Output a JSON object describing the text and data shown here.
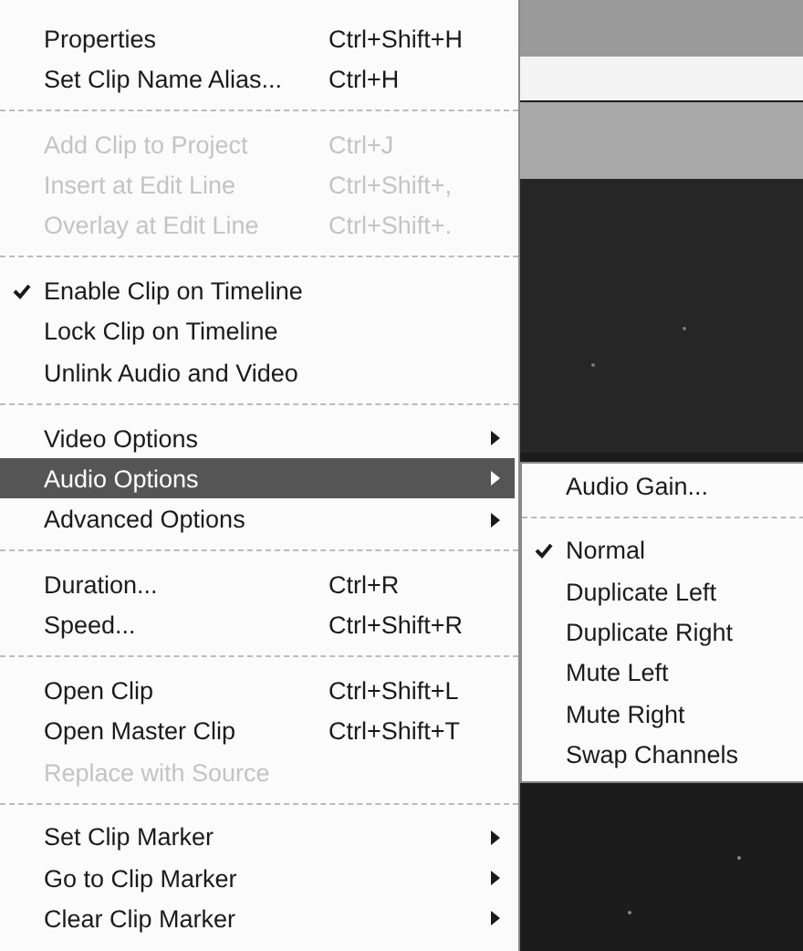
{
  "menu": {
    "items": [
      {
        "kind": "item",
        "label": "Properties",
        "shortcut": "Ctrl+Shift+H",
        "disabled": false,
        "checked": false,
        "selected": false
      },
      {
        "kind": "item",
        "label": "Set Clip Name Alias...",
        "shortcut": "Ctrl+H",
        "disabled": false,
        "checked": false,
        "selected": false
      },
      {
        "kind": "separator"
      },
      {
        "kind": "item",
        "label": "Add Clip to Project",
        "shortcut": "Ctrl+J",
        "disabled": true,
        "checked": false,
        "selected": false
      },
      {
        "kind": "item",
        "label": "Insert at Edit Line",
        "shortcut": "Ctrl+Shift+,",
        "disabled": true,
        "checked": false,
        "selected": false
      },
      {
        "kind": "item",
        "label": "Overlay at Edit Line",
        "shortcut": "Ctrl+Shift+.",
        "disabled": true,
        "checked": false,
        "selected": false
      },
      {
        "kind": "separator"
      },
      {
        "kind": "item",
        "label": "Enable Clip on Timeline",
        "disabled": false,
        "checked": true,
        "selected": false
      },
      {
        "kind": "item",
        "label": "Lock Clip on Timeline",
        "disabled": false,
        "checked": false,
        "selected": false
      },
      {
        "kind": "item",
        "label": "Unlink Audio and Video",
        "disabled": false,
        "checked": false,
        "selected": false
      },
      {
        "kind": "separator"
      },
      {
        "kind": "submenu",
        "label": "Video Options",
        "disabled": false,
        "checked": false,
        "selected": false
      },
      {
        "kind": "submenu",
        "label": "Audio Options",
        "disabled": false,
        "checked": false,
        "selected": true
      },
      {
        "kind": "submenu",
        "label": "Advanced Options",
        "disabled": false,
        "checked": false,
        "selected": false
      },
      {
        "kind": "separator"
      },
      {
        "kind": "item",
        "label": "Duration...",
        "shortcut": "Ctrl+R",
        "disabled": false,
        "checked": false,
        "selected": false
      },
      {
        "kind": "item",
        "label": "Speed...",
        "shortcut": "Ctrl+Shift+R",
        "disabled": false,
        "checked": false,
        "selected": false
      },
      {
        "kind": "separator"
      },
      {
        "kind": "item",
        "label": "Open Clip",
        "shortcut": "Ctrl+Shift+L",
        "disabled": false,
        "checked": false,
        "selected": false
      },
      {
        "kind": "item",
        "label": "Open Master Clip",
        "shortcut": "Ctrl+Shift+T",
        "disabled": false,
        "checked": false,
        "selected": false
      },
      {
        "kind": "item",
        "label": "Replace with Source",
        "disabled": true,
        "checked": false,
        "selected": false
      },
      {
        "kind": "separator"
      },
      {
        "kind": "submenu",
        "label": "Set Clip Marker",
        "disabled": false,
        "checked": false,
        "selected": false
      },
      {
        "kind": "submenu",
        "label": "Go to Clip Marker",
        "disabled": false,
        "checked": false,
        "selected": false
      },
      {
        "kind": "submenu",
        "label": "Clear Clip Marker",
        "disabled": false,
        "checked": false,
        "selected": false
      }
    ]
  },
  "submenu": {
    "items": [
      {
        "kind": "item",
        "label": "Audio Gain...",
        "checked": false
      },
      {
        "kind": "separator"
      },
      {
        "kind": "item",
        "label": "Normal",
        "checked": true
      },
      {
        "kind": "item",
        "label": "Duplicate Left",
        "checked": false
      },
      {
        "kind": "item",
        "label": "Duplicate Right",
        "checked": false
      },
      {
        "kind": "item",
        "label": "Mute Left",
        "checked": false
      },
      {
        "kind": "item",
        "label": "Mute Right",
        "checked": false
      },
      {
        "kind": "item",
        "label": "Swap Channels",
        "checked": false
      }
    ]
  }
}
